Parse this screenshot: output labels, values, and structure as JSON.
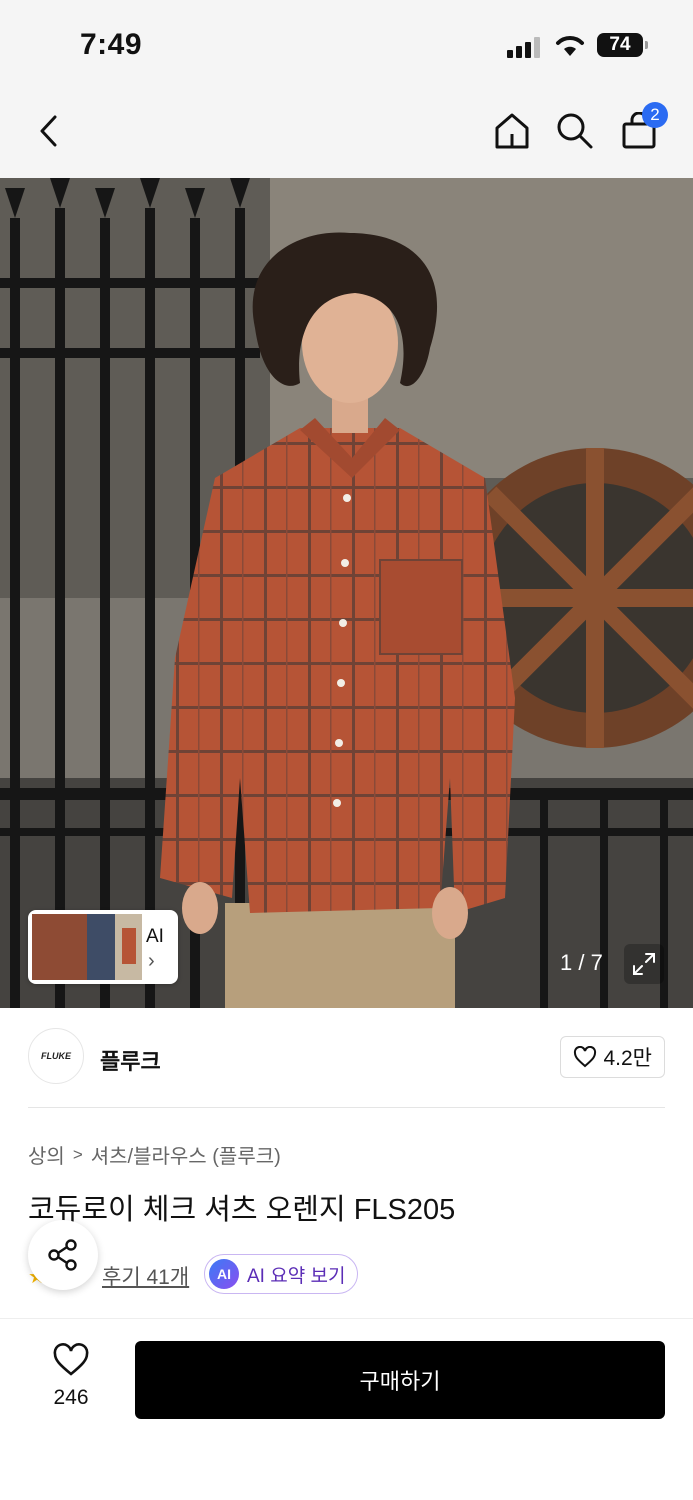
{
  "status_bar": {
    "time": "7:49",
    "battery": "74"
  },
  "nav": {
    "cart_count": "2"
  },
  "gallery": {
    "counter": "1 / 7",
    "ai_label": "AI"
  },
  "brand": {
    "name": "플루크",
    "favorite_count": "4.2만",
    "logo_text": "FLUKE"
  },
  "breadcrumb": {
    "category": "상의",
    "separator": ">",
    "subcategory": "셔츠/블라우스 (플루크)"
  },
  "product": {
    "title": "코듀로이 체크 셔츠 오렌지 FLS205"
  },
  "reviews": {
    "link": "후기 41개",
    "ai_badge": "AI",
    "ai_summary": "AI 요약 보기"
  },
  "bottom": {
    "like_count": "246",
    "buy_label": "구매하기"
  }
}
